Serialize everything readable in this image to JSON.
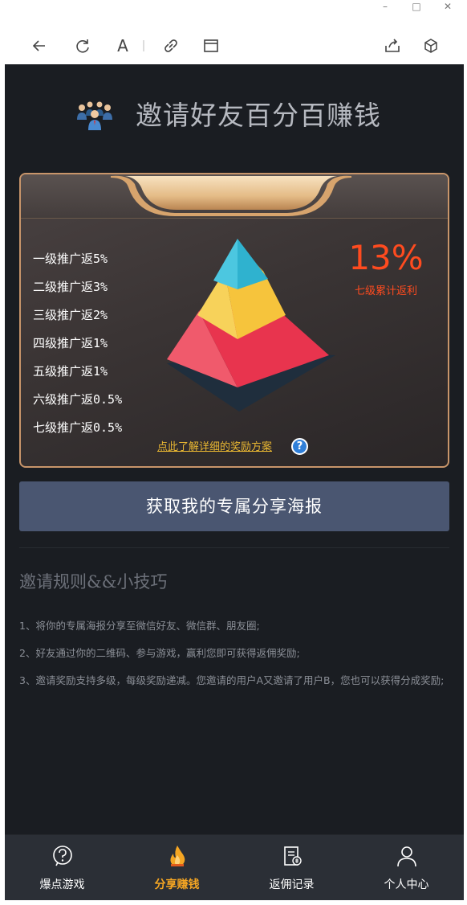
{
  "window": {
    "minimize_icon": "minimize-icon",
    "maximize_icon": "maximize-icon",
    "close_icon": "close-icon"
  },
  "toolbar": {
    "icons": [
      "back-arrow-icon",
      "refresh-icon",
      "font-icon",
      "link-icon",
      "window-icon",
      "share-icon",
      "cube-icon"
    ],
    "font_glyph": "A"
  },
  "hero": {
    "title": "邀请好友百分百赚钱",
    "icon": "people-group-icon"
  },
  "commission": {
    "levels": [
      "一级推广返5%",
      "二级推广返3%",
      "三级推广返2%",
      "四级推广返1%",
      "五级推广返1%",
      "六级推广返0.5%",
      "七级推广返0.5%"
    ],
    "total_percent": "13%",
    "total_label": "七级累计返利",
    "detail_link": "点此了解详细的奖励方案",
    "help_glyph": "?"
  },
  "poster_button": "获取我的专属分享海报",
  "rules": {
    "title": "邀请规则&&小技巧",
    "items": [
      "1、将你的专属海报分享至微信好友、微信群、朋友圈;",
      "2、好友通过你的二维码、参与游戏，赢利您即可获得返佣奖励;",
      "3、邀请奖励支持多级，每级奖励递减。您邀请的用户A又邀请了用户B，您也可以获得分成奖励;"
    ]
  },
  "bottom_nav": [
    {
      "label": "爆点游戏",
      "icon": "game-question-icon",
      "active": false
    },
    {
      "label": "分享赚钱",
      "icon": "flame-icon",
      "active": true
    },
    {
      "label": "返佣记录",
      "icon": "record-document-icon",
      "active": false
    },
    {
      "label": "个人中心",
      "icon": "user-icon",
      "active": false
    }
  ],
  "colors": {
    "app_background": "#1a1d22",
    "accent_orange": "#f5a623",
    "percent_red": "#ff4b1f",
    "button_blue": "#4a5671",
    "link_yellow": "#e9b732",
    "pyramid_top": "#2fb2cf",
    "pyramid_middle": "#f6c43c",
    "pyramid_bottom": "#e8344e"
  }
}
